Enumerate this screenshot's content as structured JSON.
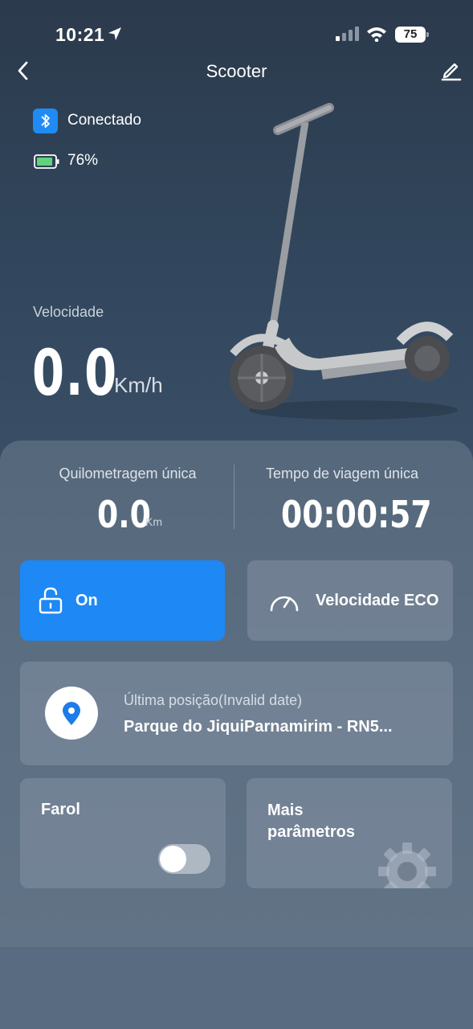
{
  "status_bar": {
    "time": "10:21",
    "battery_level": "75",
    "icons": [
      "location-arrow-icon",
      "cellular-signal-icon",
      "wifi-icon",
      "battery-icon"
    ]
  },
  "header": {
    "title": "Scooter",
    "icons": [
      "chevron-left-icon",
      "edit-pencil-icon"
    ]
  },
  "device": {
    "connection_status": "Conectado",
    "battery": "76%",
    "icons": [
      "bluetooth-icon",
      "battery-icon"
    ]
  },
  "speed": {
    "label": "Velocidade",
    "value": "0.0",
    "unit": "Km/h"
  },
  "stats": {
    "mileage_label": "Quilometragem única",
    "mileage_value": "0.0",
    "mileage_unit": "Km",
    "trip_time_label": "Tempo de viagem única",
    "trip_time_value": "00:00:57"
  },
  "controls": {
    "lock_label": "On",
    "speed_mode_label": "Velocidade ECO"
  },
  "position": {
    "label": "Última posição(Invalid date)",
    "value": "Parque do JiquiParnamirim - RN5..."
  },
  "headlight": {
    "label": "Farol",
    "enabled": false
  },
  "more": {
    "label_line1": "Mais",
    "label_line2": "parâmetros"
  },
  "colors": {
    "accent": "#1e88f4",
    "background_top": "#2b3a4c",
    "battery_green": "#5fd47a"
  }
}
